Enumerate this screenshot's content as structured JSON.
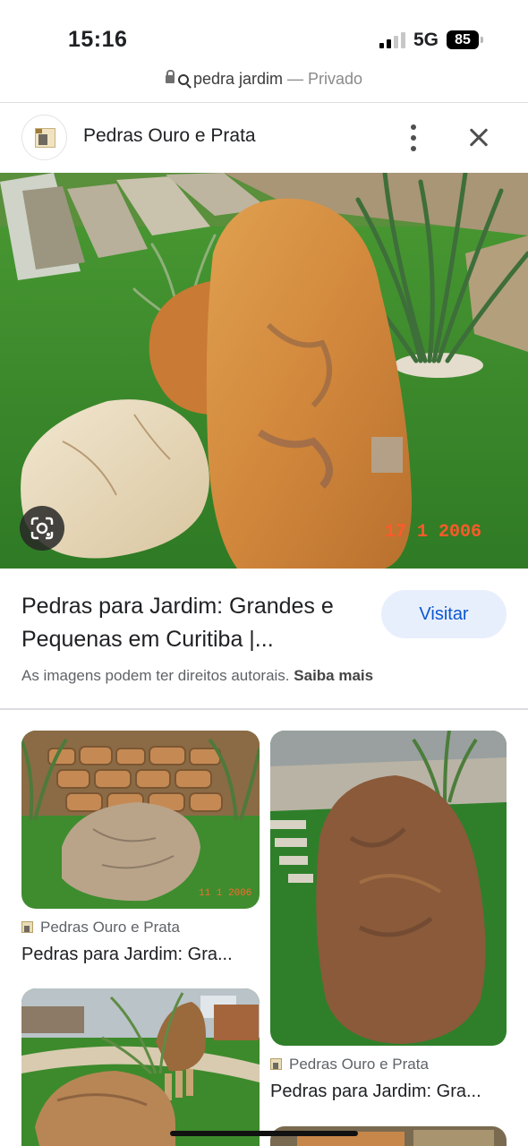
{
  "status_bar": {
    "time": "15:16",
    "network": "5G",
    "battery": "85"
  },
  "url_bar": {
    "query": "pedra jardim",
    "separator": " — ",
    "mode": "Privado"
  },
  "source": {
    "name": "Pedras Ouro e Prata",
    "menu_icon": "more-vert-icon",
    "close_icon": "close-icon"
  },
  "main_image": {
    "date_stamp": "17  1 2006",
    "lens_icon": "google-lens-icon"
  },
  "result": {
    "title": "Pedras para Jardim: Grandes e Pequenas em Curitiba |...",
    "visit_label": "Visitar",
    "copyright_text": "As imagens podem ter direitos autorais.",
    "learn_more": "Saiba mais"
  },
  "related": [
    {
      "source": "Pedras Ouro e Prata",
      "title": "Pedras para Jardim: Gra...",
      "date_stamp": "11 1 2006"
    },
    {
      "source": "Pedras Ouro e Prata",
      "title": "Pedras para Jardim: Gra..."
    },
    {},
    {}
  ],
  "colors": {
    "accent": "#0b57d0",
    "visit_bg": "#e8effc",
    "grass": "#3f8f2f",
    "stone_orange": "#d08a3a"
  }
}
